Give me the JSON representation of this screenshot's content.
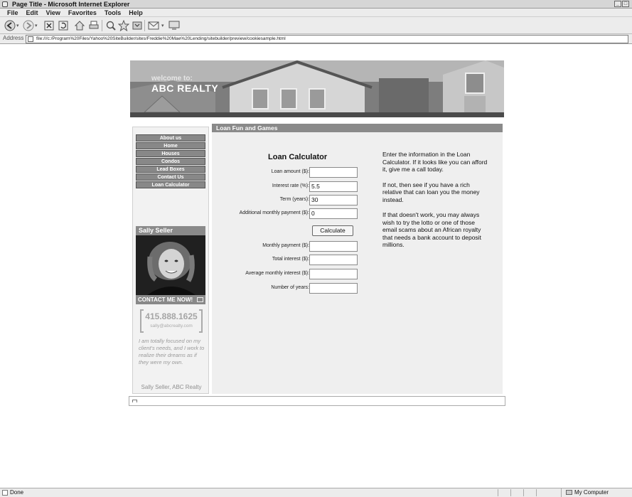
{
  "window": {
    "title": "Page Title - Microsoft Internet Explorer",
    "controls": [
      "_",
      "□"
    ]
  },
  "menu": [
    "File",
    "Edit",
    "View",
    "Favorites",
    "Tools",
    "Help"
  ],
  "address": {
    "label": "Address",
    "url": "file:///c:/Program%20Files/Yahoo%20SiteBuilder/sites/Freddie%20Mae%20Lending/sitebuilder/preview/cookiesample.html"
  },
  "site": {
    "welcome": "welcome to:",
    "brand": "ABC REALTY",
    "nav": [
      "About us",
      "Home",
      "Houses",
      "Condos",
      "Lead Boxes",
      "Contact Us",
      "Loan Calculator"
    ],
    "agent": {
      "name": "Sally Seller",
      "contact_label": "CONTACT ME NOW!",
      "phone": "415.888.1625",
      "email": "sally@abcrealty.com",
      "quote": "I am totally focused on my client's needs, and I work to realize their dreams as if they were my own.",
      "signature": "Sally Seller, ABC Realty"
    },
    "section_title": "Loan Fun and Games",
    "calculator": {
      "title": "Loan Calculator",
      "fields": [
        {
          "label": "Loan amount ($):",
          "value": ""
        },
        {
          "label": "Interest rate (%):",
          "value": "5.5"
        },
        {
          "label": "Term (years):",
          "value": "30"
        },
        {
          "label": "Additional monthly payment ($):",
          "value": "0"
        }
      ],
      "button": "Calculate",
      "outputs": [
        {
          "label": "Monthly payment ($):",
          "value": ""
        },
        {
          "label": "Total interest ($):",
          "value": ""
        },
        {
          "label": "Average monthly interest ($):",
          "value": ""
        },
        {
          "label": "Number of years:",
          "value": ""
        }
      ]
    },
    "info": [
      "Enter the information in the Loan Calculator. If it looks like you can afford it, give me a call today.",
      "If not, then see if you have a rich relative that can loan you the money instead.",
      "If that doesn't work, you may always wish to try the lotto or one of those email scams about an African royalty that needs a bank account to deposit millions."
    ]
  },
  "status": {
    "left": "Done",
    "zone": "My Computer"
  }
}
